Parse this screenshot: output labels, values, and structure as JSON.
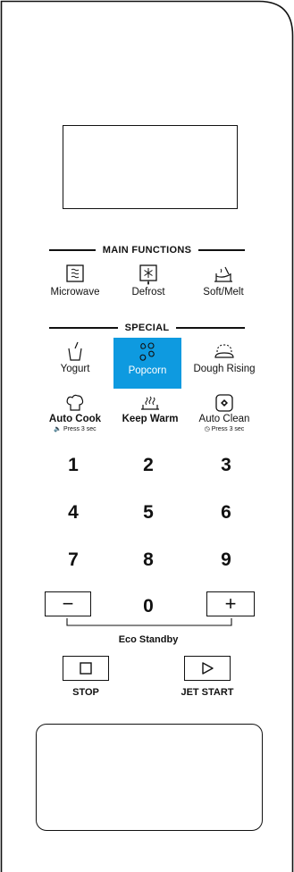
{
  "main_functions": {
    "title": "MAIN FUNCTIONS",
    "buttons": [
      {
        "label": "Microwave",
        "icon": "microwave-waves-icon"
      },
      {
        "label": "Defrost",
        "icon": "defrost-snowflake-icon"
      },
      {
        "label": "Soft/Melt",
        "icon": "soft-melt-pot-icon"
      }
    ]
  },
  "special": {
    "title": "SPECIAL",
    "buttons": [
      {
        "label": "Yogurt",
        "icon": "yogurt-cup-icon"
      },
      {
        "label": "Popcorn",
        "icon": "popcorn-icon",
        "highlight_color": "#0e9ae0"
      },
      {
        "label": "Dough Rising",
        "icon": "dough-rising-icon"
      },
      {
        "label": "Auto Cook",
        "sub": "Press 3 sec",
        "icon": "chef-hat-icon"
      },
      {
        "label": "Keep Warm",
        "icon": "keep-warm-steam-icon"
      },
      {
        "label": "Auto Clean",
        "sub": "Press 3 sec",
        "icon": "auto-clean-icon"
      }
    ]
  },
  "keypad": {
    "digits": [
      "1",
      "2",
      "3",
      "4",
      "5",
      "6",
      "7",
      "8",
      "9",
      "0"
    ],
    "minus_symbol": "−",
    "plus_symbol": "+",
    "eco_label": "Eco Standby"
  },
  "controls": {
    "stop_label": "STOP",
    "start_label": "JET START"
  }
}
